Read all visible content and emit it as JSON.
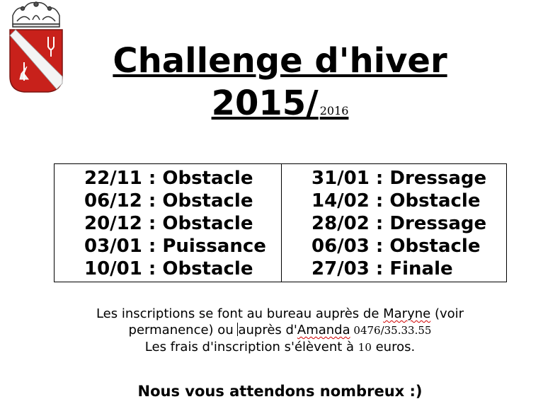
{
  "header": {
    "title_line1": "Challenge d'hiver",
    "title_line2": "2015/",
    "title_suffix": "2016"
  },
  "schedule": {
    "left": [
      "22/11 : Obstacle",
      "06/12 : Obstacle",
      "20/12 : Obstacle",
      "03/01 : Puissance",
      "10/01 : Obstacle"
    ],
    "right": [
      "31/01 : Dressage",
      "14/02 : Obstacle",
      "28/02 : Dressage",
      "06/03 : Obstacle",
      "27/03 : Finale"
    ]
  },
  "info": {
    "line1_text": "Les inscriptions se font au bureau auprès de ",
    "line1_name": "Maryne",
    "line1_end": " (voir",
    "line2_start": "permanence) ou ",
    "line2_word": "auprès",
    "line2_mid": " d'",
    "line2_name": "Amanda",
    "line2_phone": " 0476/35.33.55",
    "line3_start": "Les frais d'inscription s'élèvent à ",
    "line3_amount": "10",
    "line3_end": " euros."
  },
  "closing": "Nous vous attendons nombreux :)",
  "colors": {
    "crest_red": "#c8211b",
    "crest_white": "#f4f4f4",
    "spellcheck": "#d00000"
  }
}
